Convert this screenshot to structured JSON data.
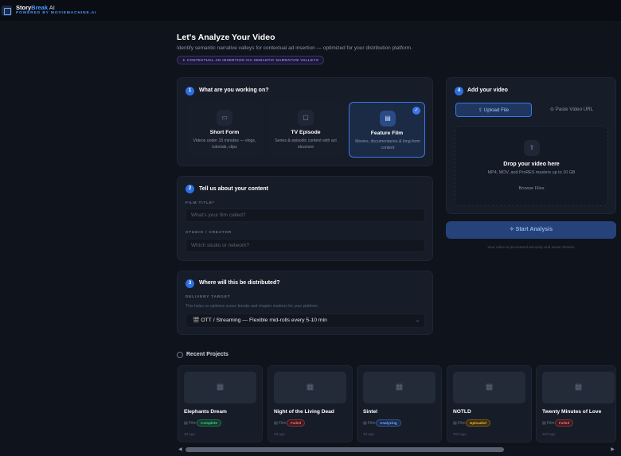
{
  "app": {
    "name_part1": "Story",
    "name_part2": "Break",
    "name_part3": " AI",
    "powered_by": "POWERED BY MOVIEMACHINE.AI"
  },
  "header": {
    "title": "Let's Analyze Your Video",
    "subtitle": "Identify semantic narrative valleys for contextual ad insertion — optimized for your distribution platform.",
    "tag": "✦ CONTEXTUAL AD INSERTION VIA SEMANTIC NARRATIVE VALLEYS"
  },
  "step1": {
    "num": "1",
    "title": "What are you working on?",
    "options": [
      {
        "icon": "▭",
        "title": "Short Form",
        "desc": "Videos under 15 minutes — vlogs, tutorials, clips"
      },
      {
        "icon": "▢",
        "title": "TV Episode",
        "desc": "Series & episodic content with act structure"
      },
      {
        "icon": "▤",
        "title": "Feature Film",
        "desc": "Movies, documentaries & long-form content"
      }
    ],
    "selected_check": "✓"
  },
  "step2": {
    "num": "2",
    "title": "Tell us about your content",
    "film_title_label": "FILM TITLE",
    "required_mark": "*",
    "film_title_placeholder": "What's your film called?",
    "studio_label": "STUDIO / CREATOR",
    "studio_placeholder": "Which studio or network?"
  },
  "step3": {
    "num": "3",
    "title": "Where will this be distributed?",
    "delivery_label": "DELIVERY TARGET",
    "hint": "This helps us optimize scene breaks and chapter markers for your platform.",
    "selected_value": "🎬 OTT / Streaming — Flexible mid-rolls every 5-10 min",
    "chevron": "⌄"
  },
  "step4": {
    "num": "4",
    "title": "Add your video",
    "tab_upload": "⇪ Upload File",
    "tab_paste": "⊝ Paste Video URL",
    "drop_icon": "⇪",
    "drop_title": "Drop your video here",
    "drop_sub": "MP4, MOV, and ProRES masters up to 10 GB",
    "browse": "Browse Files"
  },
  "actions": {
    "start": "✧ Start Analysis",
    "secure_note": "Your video is processed securely and never shared."
  },
  "recent": {
    "title": "Recent Projects",
    "projects": [
      {
        "name": "Elephants Dream",
        "type": "Film",
        "status": "Complete",
        "time": "3d ago",
        "status_color": "#3ccf8e",
        "status_bg": "#133a2b"
      },
      {
        "name": "Night of the Living Dead",
        "type": "Film",
        "status": "Failed",
        "time": "3d ago",
        "status_color": "#ff6b6b",
        "status_bg": "#3d1a1f"
      },
      {
        "name": "Sintel",
        "type": "Film",
        "status": "Analyzing",
        "time": "3d ago",
        "status_color": "#6fa8ff",
        "status_bg": "#1a2c4d"
      },
      {
        "name": "NOTLD",
        "type": "Film",
        "status": "Uploaded",
        "time": "20d ago",
        "status_color": "#f0b429",
        "status_bg": "#3a2c12"
      },
      {
        "name": "Twenty Minutes of Love",
        "type": "Film",
        "status": "Failed",
        "time": "20d ago",
        "status_color": "#ff6b6b",
        "status_bg": "#3d1a1f"
      }
    ],
    "thumb_icon": "▦",
    "film_icon": "▤"
  },
  "scroll": {
    "left": "◀",
    "right": "▶"
  }
}
